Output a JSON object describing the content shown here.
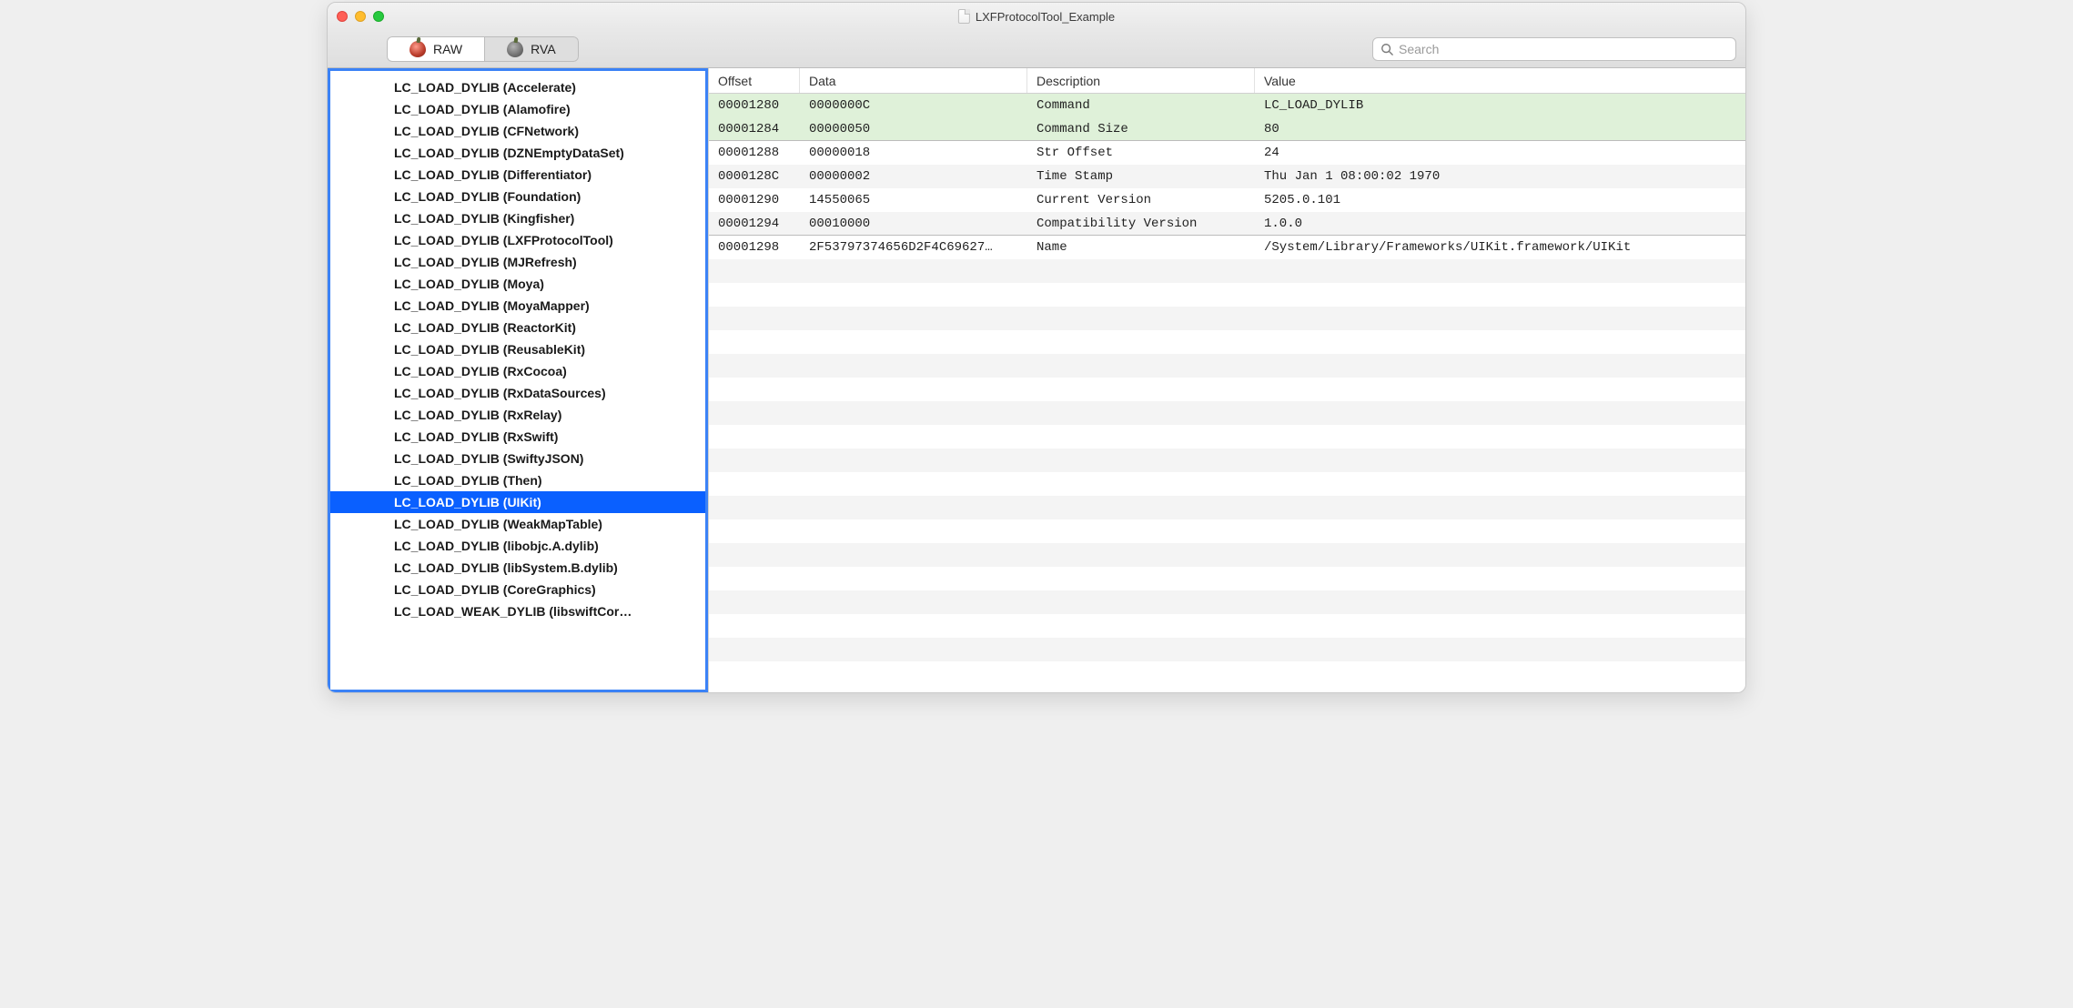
{
  "window": {
    "title": "LXFProtocolTool_Example"
  },
  "toolbar": {
    "tabs": [
      {
        "label": "RAW",
        "active": true
      },
      {
        "label": "RVA",
        "active": false
      }
    ],
    "search_placeholder": "Search"
  },
  "sidebar": {
    "items": [
      {
        "label": "LC_LOAD_DYLIB (Accelerate)",
        "selected": false
      },
      {
        "label": "LC_LOAD_DYLIB (Alamofire)",
        "selected": false
      },
      {
        "label": "LC_LOAD_DYLIB (CFNetwork)",
        "selected": false
      },
      {
        "label": "LC_LOAD_DYLIB (DZNEmptyDataSet)",
        "selected": false
      },
      {
        "label": "LC_LOAD_DYLIB (Differentiator)",
        "selected": false
      },
      {
        "label": "LC_LOAD_DYLIB (Foundation)",
        "selected": false
      },
      {
        "label": "LC_LOAD_DYLIB (Kingfisher)",
        "selected": false
      },
      {
        "label": "LC_LOAD_DYLIB (LXFProtocolTool)",
        "selected": false
      },
      {
        "label": "LC_LOAD_DYLIB (MJRefresh)",
        "selected": false
      },
      {
        "label": "LC_LOAD_DYLIB (Moya)",
        "selected": false
      },
      {
        "label": "LC_LOAD_DYLIB (MoyaMapper)",
        "selected": false
      },
      {
        "label": "LC_LOAD_DYLIB (ReactorKit)",
        "selected": false
      },
      {
        "label": "LC_LOAD_DYLIB (ReusableKit)",
        "selected": false
      },
      {
        "label": "LC_LOAD_DYLIB (RxCocoa)",
        "selected": false
      },
      {
        "label": "LC_LOAD_DYLIB (RxDataSources)",
        "selected": false
      },
      {
        "label": "LC_LOAD_DYLIB (RxRelay)",
        "selected": false
      },
      {
        "label": "LC_LOAD_DYLIB (RxSwift)",
        "selected": false
      },
      {
        "label": "LC_LOAD_DYLIB (SwiftyJSON)",
        "selected": false
      },
      {
        "label": "LC_LOAD_DYLIB (Then)",
        "selected": false
      },
      {
        "label": "LC_LOAD_DYLIB (UIKit)",
        "selected": true
      },
      {
        "label": "LC_LOAD_DYLIB (WeakMapTable)",
        "selected": false
      },
      {
        "label": "LC_LOAD_DYLIB (libobjc.A.dylib)",
        "selected": false
      },
      {
        "label": "LC_LOAD_DYLIB (libSystem.B.dylib)",
        "selected": false
      },
      {
        "label": "LC_LOAD_DYLIB (CoreGraphics)",
        "selected": false
      },
      {
        "label": "LC_LOAD_WEAK_DYLIB (libswiftCor…",
        "selected": false
      }
    ]
  },
  "table": {
    "columns": [
      {
        "label": "Offset"
      },
      {
        "label": "Data"
      },
      {
        "label": "Description"
      },
      {
        "label": "Value"
      }
    ],
    "rows": [
      {
        "offset": "00001280",
        "data": "0000000C",
        "desc": "Command",
        "value": "LC_LOAD_DYLIB",
        "highlight": "green"
      },
      {
        "offset": "00001284",
        "data": "00000050",
        "desc": "Command Size",
        "value": "80",
        "highlight": "green",
        "sep": true
      },
      {
        "offset": "00001288",
        "data": "00000018",
        "desc": "Str Offset",
        "value": "24"
      },
      {
        "offset": "0000128C",
        "data": "00000002",
        "desc": "Time Stamp",
        "value": "Thu Jan  1 08:00:02 1970"
      },
      {
        "offset": "00001290",
        "data": "14550065",
        "desc": "Current Version",
        "value": "5205.0.101"
      },
      {
        "offset": "00001294",
        "data": "00010000",
        "desc": "Compatibility Version",
        "value": "1.0.0",
        "sep": true
      },
      {
        "offset": "00001298",
        "data": "2F53797374656D2F4C69627…",
        "desc": "Name",
        "value": "/System/Library/Frameworks/UIKit.framework/UIKit"
      }
    ],
    "empty_row_count": 17
  }
}
